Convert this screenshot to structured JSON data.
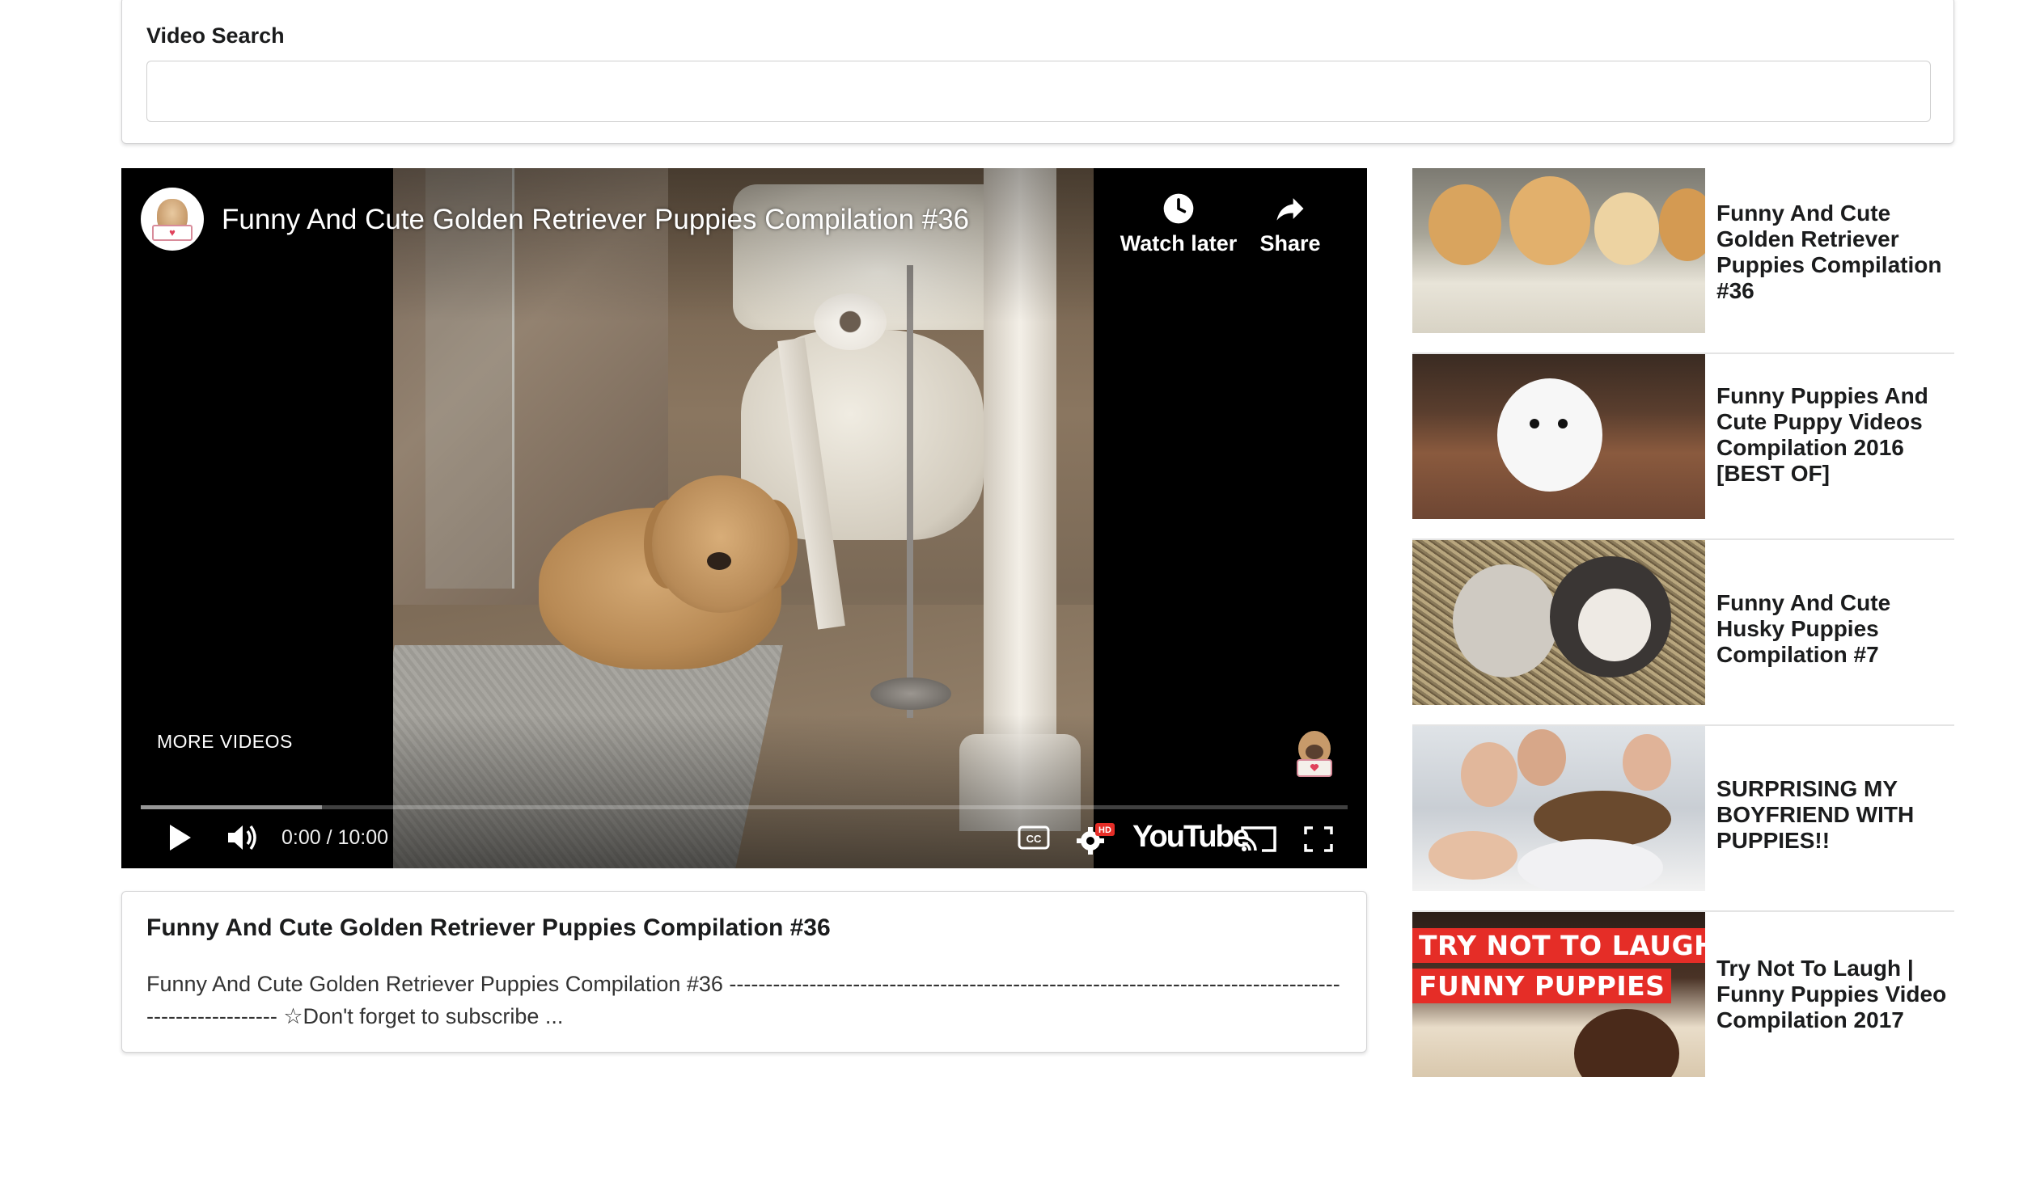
{
  "search": {
    "label": "Video Search",
    "value": "",
    "placeholder": ""
  },
  "player": {
    "title": "Funny And Cute Golden Retriever Puppies Compilation #36",
    "watch_later_label": "Watch later",
    "share_label": "Share",
    "more_videos_label": "MORE VIDEOS",
    "time": "0:00 / 10:00",
    "logo_text": "YouTube",
    "hd_badge": "HD",
    "cc_label": "CC",
    "loaded_fraction": 0.15,
    "played_fraction": 0.0
  },
  "description": {
    "title": "Funny And Cute Golden Retriever Puppies Compilation #36",
    "text": "Funny And Cute Golden Retriever Puppies Compilation #36 ------------------------------------------------------------------------------------------------------ ☆Don't forget to subscribe ..."
  },
  "sidebar": {
    "items": [
      {
        "title": "Funny And Cute Golden Retriever Puppies Compilation #36"
      },
      {
        "title": "Funny Puppies And Cute Puppy Videos Compilation 2016 [BEST OF]"
      },
      {
        "title": "Funny And Cute Husky Puppies Compilation #7"
      },
      {
        "title": "SURPRISING MY BOYFRIEND WITH PUPPIES!!"
      },
      {
        "title": "Try Not To Laugh | Funny Puppies Video Compilation 2017",
        "thumb_line1": "TRY NOT TO LAUGH",
        "thumb_line2": "FUNNY PUPPIES"
      }
    ]
  },
  "colors": {
    "player_background": "#000000",
    "hd_badge": "#e52d27",
    "thumb_banner": "#e52d27",
    "card_border": "#d4d4d5"
  }
}
